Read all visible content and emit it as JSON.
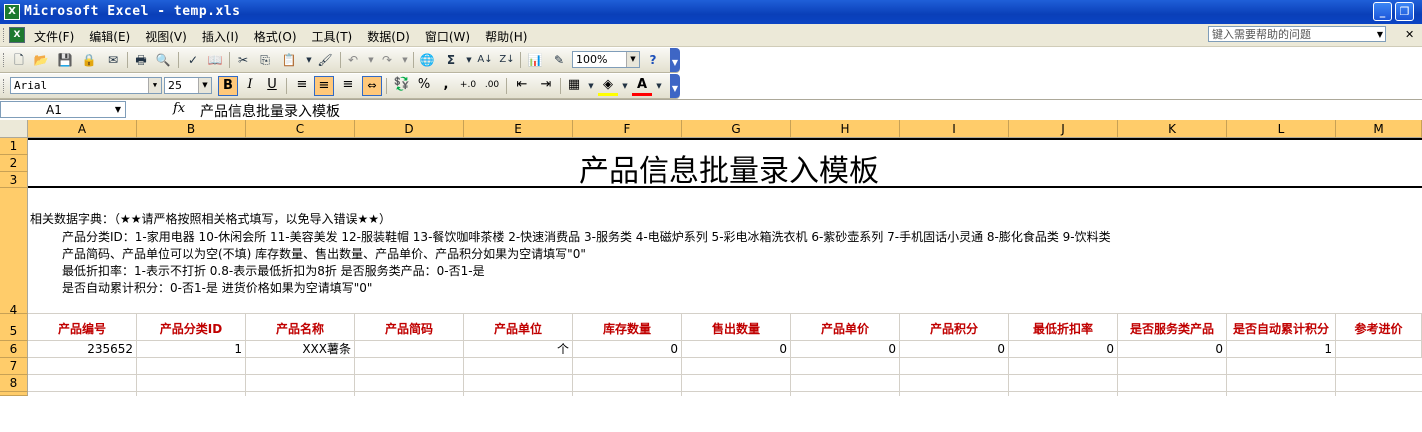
{
  "window": {
    "title": "Microsoft Excel - temp.xls",
    "buttons": {
      "minimize": "_",
      "restore": "❐",
      "close": "✕"
    }
  },
  "menu": {
    "items": [
      "文件(F)",
      "编辑(E)",
      "视图(V)",
      "插入(I)",
      "格式(O)",
      "工具(T)",
      "数据(D)",
      "窗口(W)",
      "帮助(H)"
    ],
    "help_placeholder": "键入需要帮助的问题"
  },
  "standard_toolbar": {
    "zoom": "100%"
  },
  "formatting_toolbar": {
    "font_name": "Arial",
    "font_size": "25",
    "bold": "B",
    "italic": "I",
    "underline": "U",
    "percent": "%",
    "comma": ","
  },
  "formula_bar": {
    "cell_ref": "A1",
    "fx": "fx",
    "value": "产品信息批量录入模板"
  },
  "columns": [
    "A",
    "B",
    "C",
    "D",
    "E",
    "F",
    "G",
    "H",
    "I",
    "J",
    "K",
    "L",
    "M"
  ],
  "rows": [
    "1",
    "2",
    "3",
    "4",
    "5",
    "6",
    "7",
    "8"
  ],
  "sheet": {
    "title": "产品信息批量录入模板",
    "dictionary": {
      "line1": "相关数据字典：（★★请严格按照相关格式填写，以免导入错误★★）",
      "line2": "产品分类ID：1-家用电器  10-休闲会所  11-美容美发  12-服装鞋帽  13-餐饮咖啡茶楼  2-快速消费品  3-服务类  4-电磁炉系列  5-彩电冰箱洗衣机  6-紫砂壶系列  7-手机固话小灵通  8-膨化食品类  9-饮料类",
      "line3": "产品简码、产品单位可以为空(不填)    库存数量、售出数量、产品单价、产品积分如果为空请填写\"0\"",
      "line4": "最低折扣率：1-表示不打折 0.8-表示最低折扣为8折   是否服务类产品：0-否1-是",
      "line5": "是否自动累计积分：0-否1-是    进货价格如果为空请填写\"0\""
    },
    "headers": [
      "产品编号",
      "产品分类ID",
      "产品名称",
      "产品简码",
      "产品单位",
      "库存数量",
      "售出数量",
      "产品单价",
      "产品积分",
      "最低折扣率",
      "是否服务类产品",
      "是否自动累计积分",
      "参考进价"
    ],
    "row6": [
      "235652",
      "1",
      "XXX薯条",
      "",
      "个",
      "0",
      "0",
      "0",
      "0",
      "0",
      "0",
      "1",
      ""
    ]
  }
}
